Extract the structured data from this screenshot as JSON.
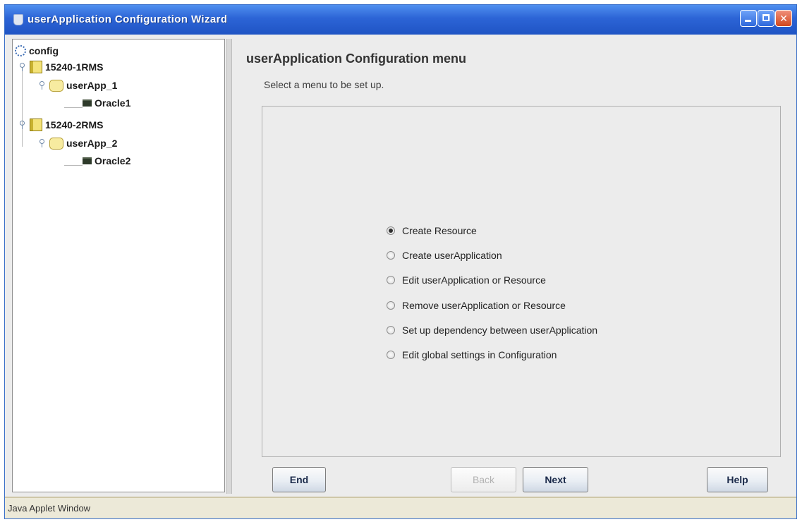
{
  "window": {
    "title": "userApplication Configuration Wizard",
    "accent_color": "#2c64d6"
  },
  "tree": {
    "root": "config",
    "nodes": [
      {
        "label": "15240-1RMS",
        "icon": "rms-book-icon"
      },
      {
        "label": "userApp_1",
        "icon": "folder-icon"
      },
      {
        "label": "Oracle1",
        "icon": "resource-icon"
      },
      {
        "label": "15240-2RMS",
        "icon": "rms-book-icon"
      },
      {
        "label": "userApp_2",
        "icon": "folder-icon"
      },
      {
        "label": "Oracle2",
        "icon": "resource-icon"
      }
    ]
  },
  "menu": {
    "title": "userApplication Configuration menu",
    "subtitle": "Select a menu to be set up.",
    "options": [
      {
        "label": "Create Resource",
        "selected": true
      },
      {
        "label": "Create userApplication",
        "selected": false
      },
      {
        "label": "Edit userApplication or Resource",
        "selected": false
      },
      {
        "label": "Remove userApplication or Resource",
        "selected": false
      },
      {
        "label": "Set up dependency between userApplication",
        "selected": false
      },
      {
        "label": "Edit global settings in Configuration",
        "selected": false
      }
    ]
  },
  "buttons": {
    "end": "End",
    "back": "Back",
    "next": "Next",
    "help": "Help"
  },
  "status": {
    "text": "Java Applet Window"
  }
}
